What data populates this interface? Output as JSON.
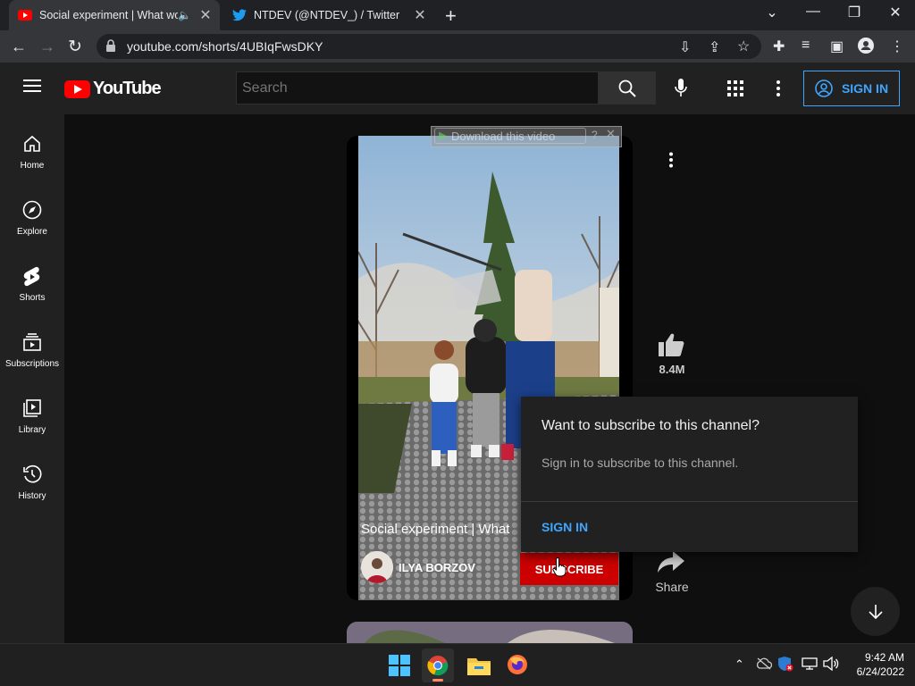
{
  "browser": {
    "tabs": [
      {
        "title": "Social experiment | What wo",
        "icon": "youtube-favicon"
      },
      {
        "title": "NTDEV (@NTDEV_) / Twitter",
        "icon": "twitter-favicon"
      }
    ],
    "url": "youtube.com/shorts/4UBIqFwsDKY"
  },
  "youtube": {
    "logo_text": "YouTube",
    "search_placeholder": "Search",
    "sign_in_label": "SIGN IN"
  },
  "sidebar": {
    "items": [
      {
        "label": "Home",
        "icon": "home-icon"
      },
      {
        "label": "Explore",
        "icon": "compass-icon"
      },
      {
        "label": "Shorts",
        "icon": "shorts-icon"
      },
      {
        "label": "Subscriptions",
        "icon": "subscriptions-icon"
      },
      {
        "label": "Library",
        "icon": "library-icon"
      },
      {
        "label": "History",
        "icon": "history-icon"
      }
    ]
  },
  "video": {
    "download_overlay": "Download this video",
    "title": "Social experiment | What",
    "channel": "ILYA BORZOV",
    "subscribe_label": "SUBSCRIBE",
    "like_count": "8.4M",
    "share_label": "Share"
  },
  "popup": {
    "title": "Want to subscribe to this channel?",
    "message": "Sign in to subscribe to this channel.",
    "sign_in": "SIGN IN"
  },
  "taskbar": {
    "time": "9:42 AM",
    "date": "6/24/2022"
  },
  "colors": {
    "yt_red": "#ff0000",
    "subscribe_red": "#cc0000",
    "link_blue": "#3ea6ff",
    "yt_bg": "#0f0f0f",
    "panel": "#212121"
  }
}
